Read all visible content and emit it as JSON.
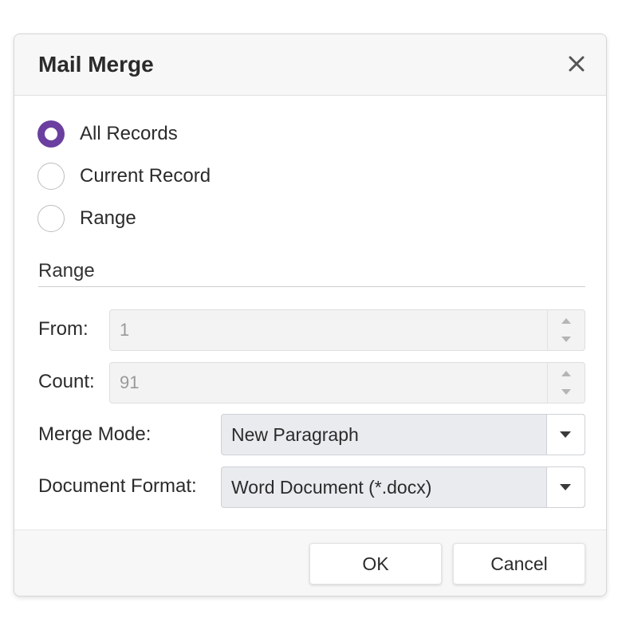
{
  "dialog": {
    "title": "Mail Merge",
    "close_icon": "close-icon"
  },
  "records": {
    "options": [
      {
        "label": "All Records",
        "checked": true
      },
      {
        "label": "Current Record",
        "checked": false
      },
      {
        "label": "Range",
        "checked": false
      }
    ]
  },
  "range": {
    "group_title": "Range",
    "from_label": "From:",
    "from_value": "1",
    "count_label": "Count:",
    "count_value": "91"
  },
  "merge_mode": {
    "label": "Merge Mode:",
    "value": "New Paragraph"
  },
  "document_format": {
    "label": "Document Format:",
    "value": "Word Document (*.docx)"
  },
  "footer": {
    "ok_label": "OK",
    "cancel_label": "Cancel"
  },
  "colors": {
    "accent": "#6b3fa0"
  }
}
